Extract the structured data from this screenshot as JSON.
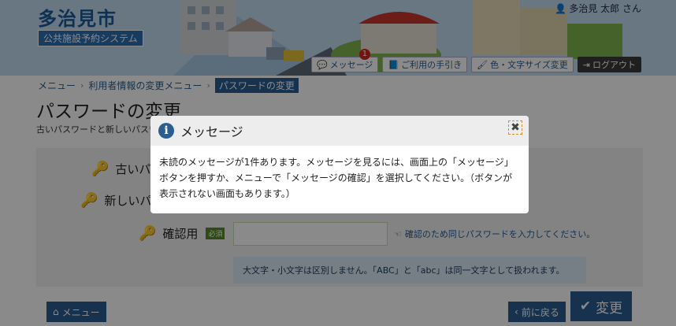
{
  "header": {
    "city": "多治見市",
    "system": "公共施設予約システム",
    "user": "多治見 太郎 さん",
    "buttons": {
      "message": "メッセージ",
      "message_count": "1",
      "guide": "ご利用の手引き",
      "color": "色・文字サイズ変更",
      "logout": "ログアウト"
    }
  },
  "breadcrumb": {
    "menu": "メニュー",
    "userinfo": "利用者情報の変更メニュー",
    "current": "パスワードの変更"
  },
  "page": {
    "title": "パスワードの変更",
    "desc": "古いパスワードと新しいパスワ"
  },
  "form": {
    "old_label": "古いパ",
    "new_label": "新しいパ",
    "confirm_label": "確認用",
    "required": "必須",
    "hint": "確認のため同じパスワードを入力してください。",
    "note": "大文字・小文字は区別しません。「ABC」と「abc」は同一文字として扱われます。"
  },
  "footer": {
    "menu": "メニュー",
    "back": "前に戻る",
    "change": "変更"
  },
  "modal": {
    "title": "メッセージ",
    "close": "✖",
    "body": "未読のメッセージが1件あります。メッセージを見るには、画面上の「メッセージ」ボタンを押すか、メニューで「メッセージの確認」を選択してください。（ボタンが表示されない画面もあります。）"
  }
}
